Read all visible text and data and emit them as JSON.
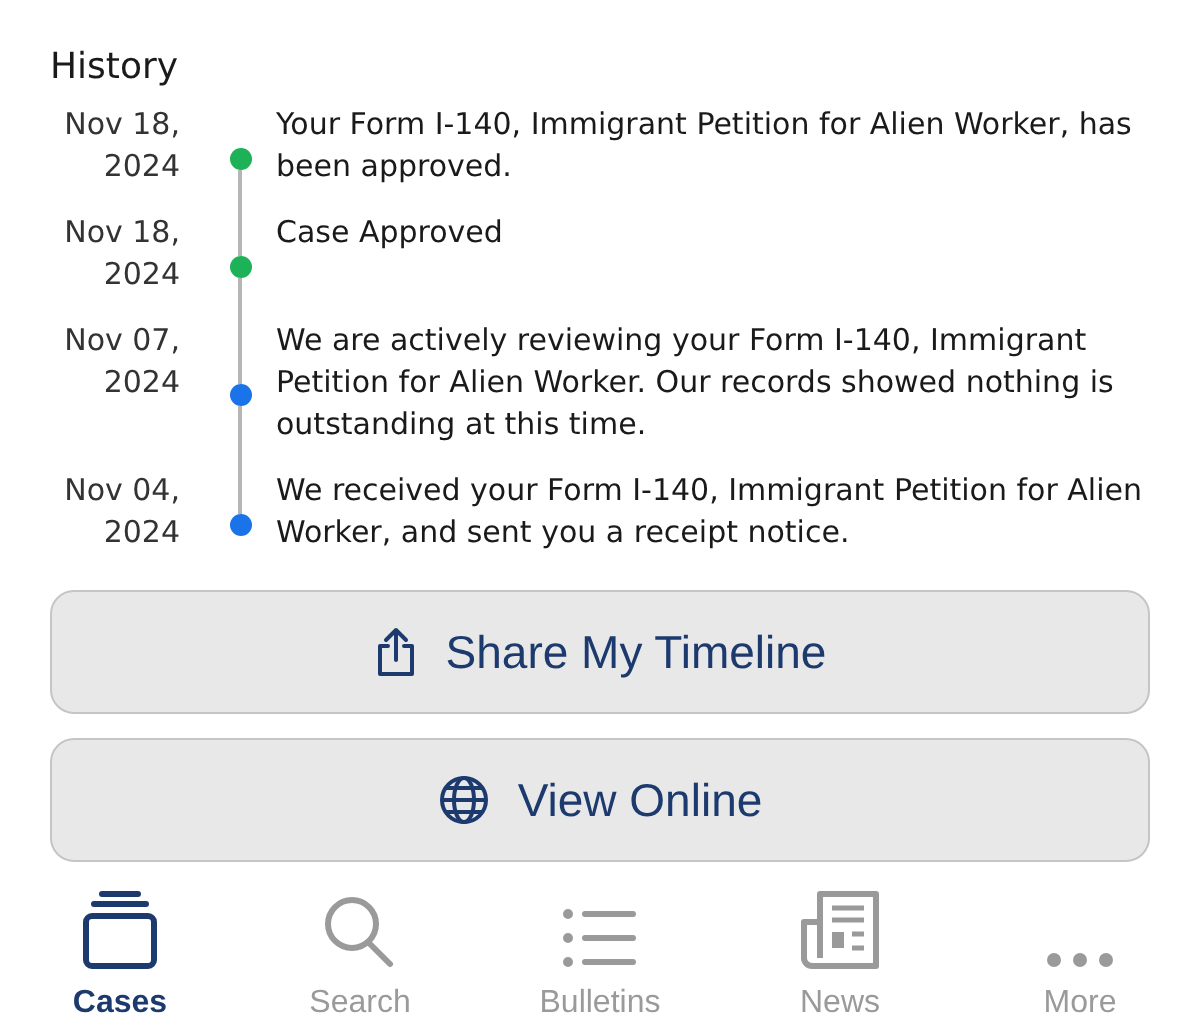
{
  "section_title": "History",
  "history": [
    {
      "date": "Nov 18, 2024",
      "text": "Your Form I-140, Immigrant Petition for Alien Worker, has been approved.",
      "color": "#1db257"
    },
    {
      "date": "Nov 18, 2024",
      "text": "Case Approved",
      "color": "#1db257"
    },
    {
      "date": "Nov 07, 2024",
      "text": "We are actively reviewing your Form I-140, Immigrant Petition for Alien Worker. Our records showed nothing is outstanding at this time.",
      "color": "#1a73e8"
    },
    {
      "date": "Nov 04, 2024",
      "text": "We received your Form I-140, Immigrant Petition for Alien Worker, and sent you a receipt notice.",
      "color": "#1a73e8"
    }
  ],
  "buttons": [
    {
      "kind": "share",
      "label": "Share My Timeline"
    },
    {
      "kind": "globe",
      "label": "View Online"
    }
  ],
  "tabs": [
    {
      "kind": "cases",
      "label": "Cases",
      "selected": true
    },
    {
      "kind": "search",
      "label": "Search",
      "selected": false
    },
    {
      "kind": "list",
      "label": "Bulletins",
      "selected": false
    },
    {
      "kind": "news",
      "label": "News",
      "selected": false
    },
    {
      "kind": "more",
      "label": "More",
      "selected": false
    }
  ]
}
